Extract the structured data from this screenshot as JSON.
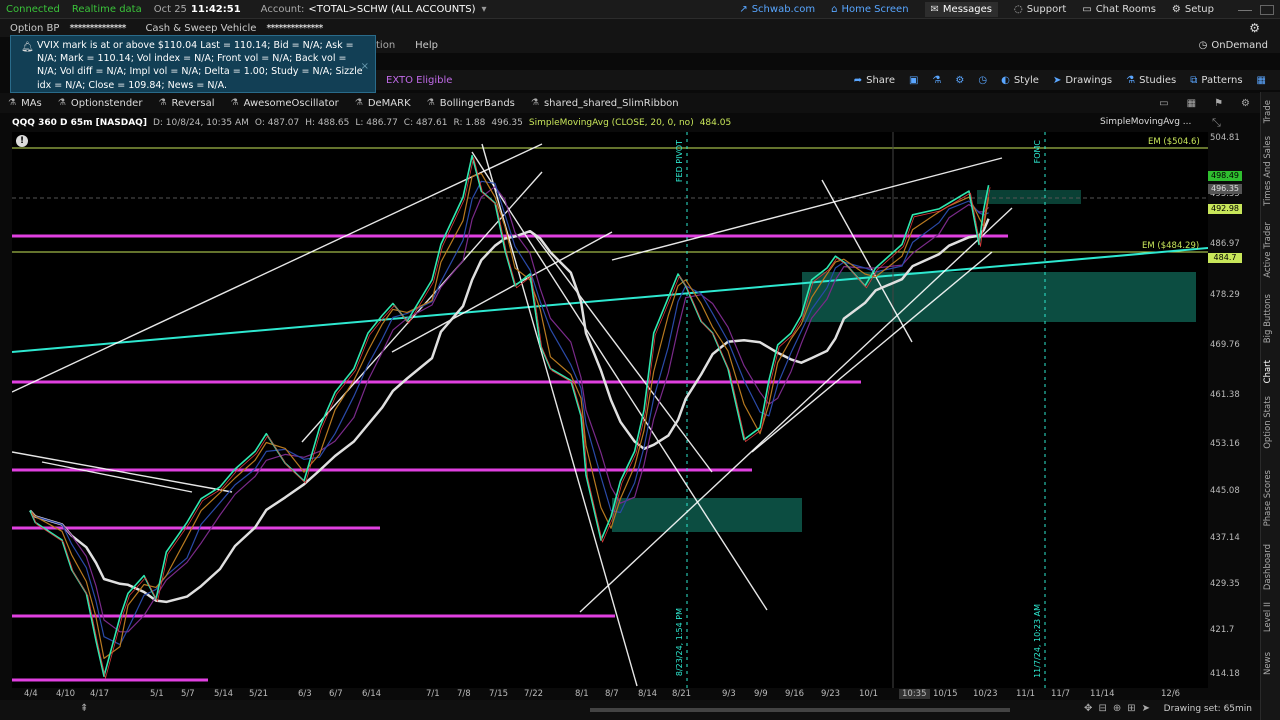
{
  "topbar": {
    "connected": "Connected",
    "realtime": "Realtime data",
    "date": "Oct 25",
    "time": "11:42:51",
    "account_label": "Account:",
    "account_value": "<TOTAL>SCHW (ALL ACCOUNTS)",
    "links": [
      {
        "label": "Schwab.com",
        "icon": "external-link-icon"
      },
      {
        "label": "Home Screen",
        "icon": "home-icon"
      },
      {
        "label": "Messages",
        "icon": "message-icon"
      },
      {
        "label": "Support",
        "icon": "support-icon"
      },
      {
        "label": "Chat Rooms",
        "icon": "chat-icon"
      },
      {
        "label": "Setup",
        "icon": "gear-icon"
      }
    ]
  },
  "row2": {
    "option_bp": "Option BP",
    "option_bp_value": "**************",
    "cash_sweep": "Cash & Sweep Vehicle",
    "cash_sweep_value": "**************"
  },
  "alert": {
    "text": "VVIX mark is at or above $110.04 Last = 110.14; Bid = N/A; Ask = N/A; Mark = 110.14; Vol index = N/A; Front vol = N/A; Back vol = N/A; Vol diff = N/A; Impl vol = N/A; Delta = 1.00; Study = N/A; Sizzle idx = N/A; Close = 109.84; News = N/A."
  },
  "menu": {
    "partial": "tion",
    "help": "Help",
    "ondemand": "OnDemand"
  },
  "toolbar": {
    "exto": "EXTO Eligible",
    "share": "Share",
    "style": "Style",
    "drawings": "Drawings",
    "studies": "Studies",
    "patterns": "Patterns"
  },
  "studies": [
    "MAs",
    "Optionstender",
    "Reversal",
    "AwesomeOscillator",
    "DeMARK",
    "BollingerBands",
    "shared_shared_SlimRibbon"
  ],
  "chart_header": {
    "symbol": "QQQ 360 D 65m [NASDAQ]",
    "date": "D: 10/8/24, 10:35 AM",
    "open": "O: 487.07",
    "high": "H: 488.65",
    "low": "L: 486.77",
    "close": "C: 487.61",
    "range": "R: 1.88",
    "value": "496.35",
    "sma": "SimpleMovingAvg (CLOSE, 20, 0, no)",
    "sma_value": "484.05",
    "sma_label": "SimpleMovingAvg ..."
  },
  "chart_data": {
    "type": "line",
    "symbol": "QQQ",
    "aggregation": "65m",
    "y_ticks": [
      "504.81",
      "495.35",
      "486.97",
      "478.29",
      "469.76",
      "461.38",
      "453.16",
      "445.08",
      "437.14",
      "429.35",
      "421.7",
      "414.18"
    ],
    "ylim": [
      412,
      506
    ],
    "x_ticks": [
      "4/4",
      "4/10",
      "4/17",
      "5/1",
      "5/7",
      "5/14",
      "5/21",
      "6/3",
      "6/7",
      "6/14",
      "7/1",
      "7/8",
      "7/15",
      "7/22",
      "8/1",
      "8/7",
      "8/14",
      "8/21",
      "9/3",
      "9/9",
      "9/16",
      "9/23",
      "10/1",
      "10:35",
      "10/15",
      "10/23",
      "11/1",
      "11/7",
      "11/14",
      "12/6"
    ],
    "price_tags": [
      {
        "value": "498.49",
        "color": "#2fbf2f"
      },
      {
        "value": "496.35",
        "color": "#555555"
      },
      {
        "value": "492.98",
        "color": "#c8e65a"
      },
      {
        "value": "484.7",
        "color": "#c8e65a"
      }
    ],
    "annotations": {
      "em_high": "EM ($504.6)",
      "em_low": "EM ($484.29)",
      "fed_pivot": "FED PIVOT",
      "fomc": "FOMC",
      "date_823": "8/23/24, 1:54 PM",
      "date_117": "11/7/24, 10:23 AM"
    },
    "price_series": [
      [
        "4/4",
        442
      ],
      [
        "4/5",
        440
      ],
      [
        "4/10",
        437
      ],
      [
        "4/12",
        432
      ],
      [
        "4/15",
        428
      ],
      [
        "4/17",
        420
      ],
      [
        "4/19",
        414
      ],
      [
        "4/23",
        424
      ],
      [
        "4/25",
        428
      ],
      [
        "4/29",
        431
      ],
      [
        "5/1",
        427
      ],
      [
        "5/3",
        435
      ],
      [
        "5/7",
        440
      ],
      [
        "5/10",
        444
      ],
      [
        "5/14",
        446
      ],
      [
        "5/17",
        449
      ],
      [
        "5/21",
        452
      ],
      [
        "5/24",
        455
      ],
      [
        "5/29",
        450
      ],
      [
        "6/3",
        447
      ],
      [
        "6/5",
        456
      ],
      [
        "6/7",
        462
      ],
      [
        "6/11",
        466
      ],
      [
        "6/14",
        472
      ],
      [
        "6/18",
        475
      ],
      [
        "6/21",
        477
      ],
      [
        "6/25",
        474
      ],
      [
        "7/1",
        481
      ],
      [
        "7/3",
        487
      ],
      [
        "7/8",
        495
      ],
      [
        "7/10",
        502
      ],
      [
        "7/12",
        496
      ],
      [
        "7/15",
        494
      ],
      [
        "7/17",
        486
      ],
      [
        "7/19",
        480
      ],
      [
        "7/22",
        482
      ],
      [
        "7/24",
        470
      ],
      [
        "7/26",
        466
      ],
      [
        "7/30",
        464
      ],
      [
        "8/1",
        458
      ],
      [
        "8/2",
        448
      ],
      [
        "8/5",
        437
      ],
      [
        "8/7",
        441
      ],
      [
        "8/9",
        447
      ],
      [
        "8/12",
        452
      ],
      [
        "8/14",
        459
      ],
      [
        "8/16",
        472
      ],
      [
        "8/19",
        478
      ],
      [
        "8/21",
        482
      ],
      [
        "8/23",
        480
      ],
      [
        "8/27",
        474
      ],
      [
        "8/30",
        472
      ],
      [
        "9/3",
        466
      ],
      [
        "9/6",
        454
      ],
      [
        "9/9",
        456
      ],
      [
        "9/11",
        464
      ],
      [
        "9/13",
        470
      ],
      [
        "9/16",
        472
      ],
      [
        "9/18",
        475
      ],
      [
        "9/20",
        481
      ],
      [
        "9/23",
        483
      ],
      [
        "9/25",
        485
      ],
      [
        "9/27",
        484
      ],
      [
        "10/1",
        480
      ],
      [
        "10/3",
        483
      ],
      [
        "10/8",
        487
      ],
      [
        "10/10",
        492
      ],
      [
        "10/15",
        493
      ],
      [
        "10/17",
        494
      ],
      [
        "10/21",
        496
      ],
      [
        "10/23",
        487
      ],
      [
        "10/24",
        493
      ],
      [
        "10/25",
        497
      ]
    ]
  },
  "bottom": {
    "drawing_set": "Drawing set: 65min"
  },
  "side_tabs": [
    "Trade",
    "Times And Sales",
    "Active Trader",
    "Big Buttons",
    "Chart",
    "Option Stats",
    "Phase Scores",
    "Dashboard",
    "Level II",
    "News"
  ],
  "colors": {
    "accent": "#58a6ff",
    "magenta_line": "#e040e0",
    "cyan_line": "#2ee8d0",
    "zone_fill": "#0e5b4c"
  }
}
